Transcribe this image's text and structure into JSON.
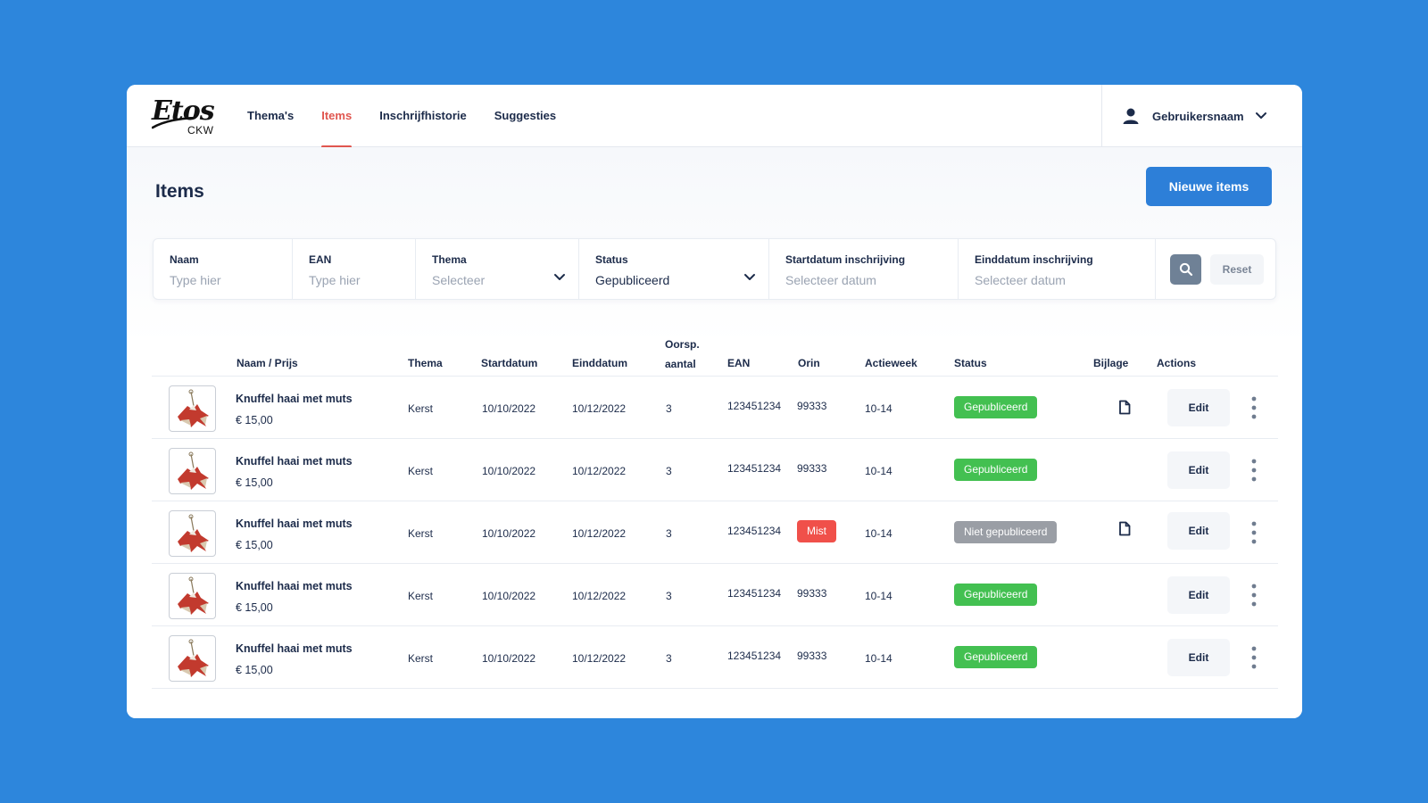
{
  "header": {
    "logo": {
      "brand": "Etos",
      "sub": "CKW"
    },
    "nav": [
      {
        "label": "Thema's",
        "active": false
      },
      {
        "label": "Items",
        "active": true
      },
      {
        "label": "Inschrijfhistorie",
        "active": false
      },
      {
        "label": "Suggesties",
        "active": false
      }
    ],
    "user": {
      "name": "Gebruikersnaam",
      "icon": "user-icon"
    }
  },
  "page": {
    "title": "Items",
    "new_button": "Nieuwe items"
  },
  "filters": {
    "naam": {
      "label": "Naam",
      "placeholder": "Type hier"
    },
    "ean": {
      "label": "EAN",
      "placeholder": "Type hier"
    },
    "thema": {
      "label": "Thema",
      "placeholder": "Selecteer"
    },
    "status": {
      "label": "Status",
      "value": "Gepubliceerd"
    },
    "startdatum": {
      "label": "Startdatum inschrijving",
      "placeholder": "Selecteer datum"
    },
    "einddatum": {
      "label": "Einddatum inschrijving",
      "placeholder": "Selecteer datum"
    },
    "reset": "Reset"
  },
  "table": {
    "headers": {
      "naam": "Naam / Prijs",
      "thema": "Thema",
      "start": "Startdatum",
      "eind": "Einddatum",
      "oorsp_1": "Oorsp.",
      "oorsp_2": "aantal",
      "ean": "EAN",
      "orin": "Orin",
      "actieweek": "Actieweek",
      "status": "Status",
      "bijlage": "Bijlage",
      "actions": "Actions"
    },
    "edit_label": "Edit",
    "rows": [
      {
        "name": "Knuffel haai met muts",
        "price": "€ 15,00",
        "thema": "Kerst",
        "start": "10/10/2022",
        "eind": "10/12/2022",
        "aantal": "3",
        "ean": "123451234",
        "orin": "99333",
        "orin_missing": false,
        "week": "10-14",
        "status": "Gepubliceerd",
        "status_type": "ok",
        "attachment": true
      },
      {
        "name": "Knuffel haai met muts",
        "price": "€ 15,00",
        "thema": "Kerst",
        "start": "10/10/2022",
        "eind": "10/12/2022",
        "aantal": "3",
        "ean": "123451234",
        "orin": "99333",
        "orin_missing": false,
        "week": "10-14",
        "status": "Gepubliceerd",
        "status_type": "ok",
        "attachment": false
      },
      {
        "name": "Knuffel haai met muts",
        "price": "€ 15,00",
        "thema": "Kerst",
        "start": "10/10/2022",
        "eind": "10/12/2022",
        "aantal": "3",
        "ean": "123451234",
        "orin": "Mist",
        "orin_missing": true,
        "week": "10-14",
        "status": "Niet gepubliceerd",
        "status_type": "no",
        "attachment": true
      },
      {
        "name": "Knuffel haai met muts",
        "price": "€ 15,00",
        "thema": "Kerst",
        "start": "10/10/2022",
        "eind": "10/12/2022",
        "aantal": "3",
        "ean": "123451234",
        "orin": "99333",
        "orin_missing": false,
        "week": "10-14",
        "status": "Gepubliceerd",
        "status_type": "ok",
        "attachment": false
      },
      {
        "name": "Knuffel haai met muts",
        "price": "€ 15,00",
        "thema": "Kerst",
        "start": "10/10/2022",
        "eind": "10/12/2022",
        "aantal": "3",
        "ean": "123451234",
        "orin": "99333",
        "orin_missing": false,
        "week": "10-14",
        "status": "Gepubliceerd",
        "status_type": "ok",
        "attachment": false
      }
    ]
  },
  "colors": {
    "background": "#2d86dc",
    "primary": "#2d7fd8",
    "active_nav": "#e0564f",
    "published": "#43c051",
    "not_published": "#9a9ea5",
    "missing": "#f0504a"
  }
}
